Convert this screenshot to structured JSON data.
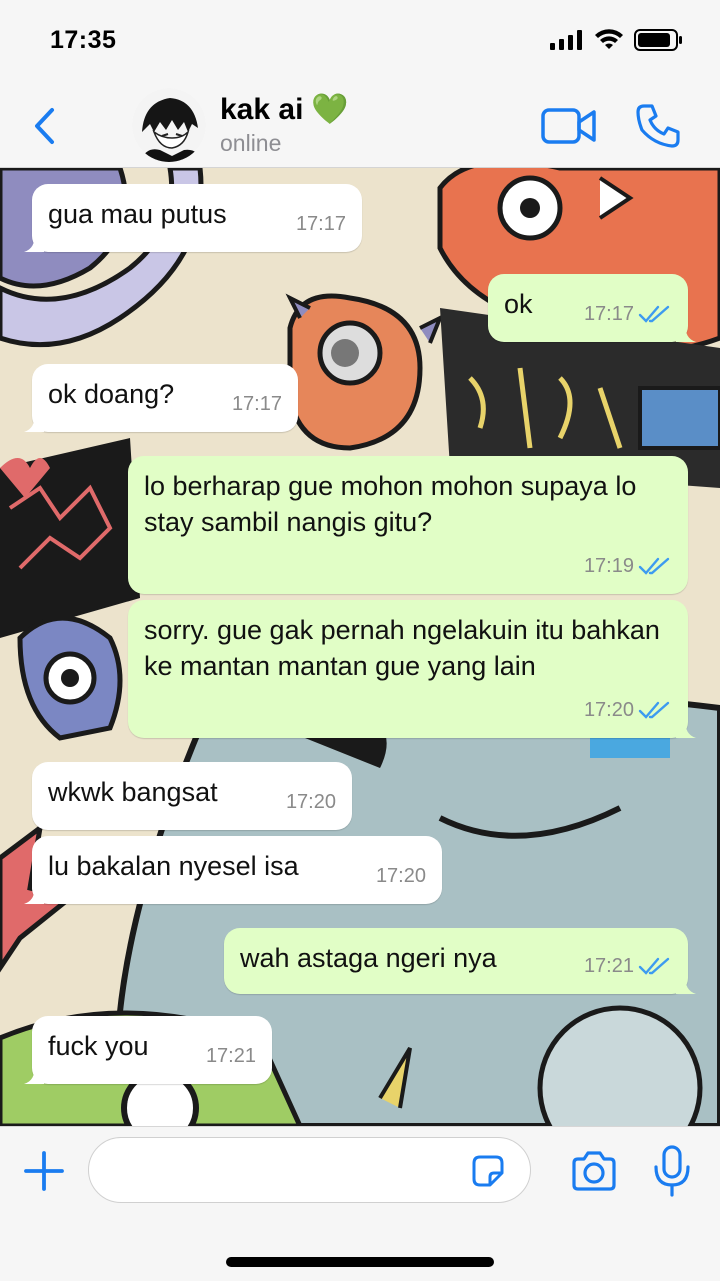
{
  "status_bar": {
    "time": "17:35"
  },
  "header": {
    "contact_name": "kak ai",
    "contact_emoji": "💚",
    "contact_status": "online"
  },
  "messages": [
    {
      "direction": "in",
      "text": "gua mau putus",
      "time": "17:17"
    },
    {
      "direction": "out",
      "text": "ok",
      "time": "17:17",
      "read": true
    },
    {
      "direction": "in",
      "text": "ok doang?",
      "time": "17:17"
    },
    {
      "direction": "out",
      "text": "lo berharap gue mohon mohon supaya lo stay sambil nangis gitu?",
      "time": "17:19",
      "read": true
    },
    {
      "direction": "out",
      "text": "sorry. gue gak pernah ngelakuin itu bahkan ke mantan mantan gue yang lain",
      "time": "17:20",
      "read": true
    },
    {
      "direction": "in",
      "text": "wkwk bangsat",
      "time": "17:20"
    },
    {
      "direction": "in",
      "text": "lu bakalan nyesel isa",
      "time": "17:20"
    },
    {
      "direction": "out",
      "text": "wah astaga ngeri nya",
      "time": "17:21",
      "read": true
    },
    {
      "direction": "in",
      "text": "fuck you",
      "time": "17:21"
    }
  ],
  "input": {
    "placeholder": ""
  },
  "icons": {
    "back": "chevron-left-icon",
    "video": "video-camera-icon",
    "call": "phone-icon",
    "plus": "plus-icon",
    "sticker": "sticker-icon",
    "camera": "camera-icon",
    "mic": "microphone-icon",
    "read_receipt": "double-check-icon"
  },
  "colors": {
    "accent": "#1a7cf0",
    "incoming_bubble": "#ffffff",
    "outgoing_bubble": "#e1fec6",
    "read_tick": "#3d9bf0"
  }
}
